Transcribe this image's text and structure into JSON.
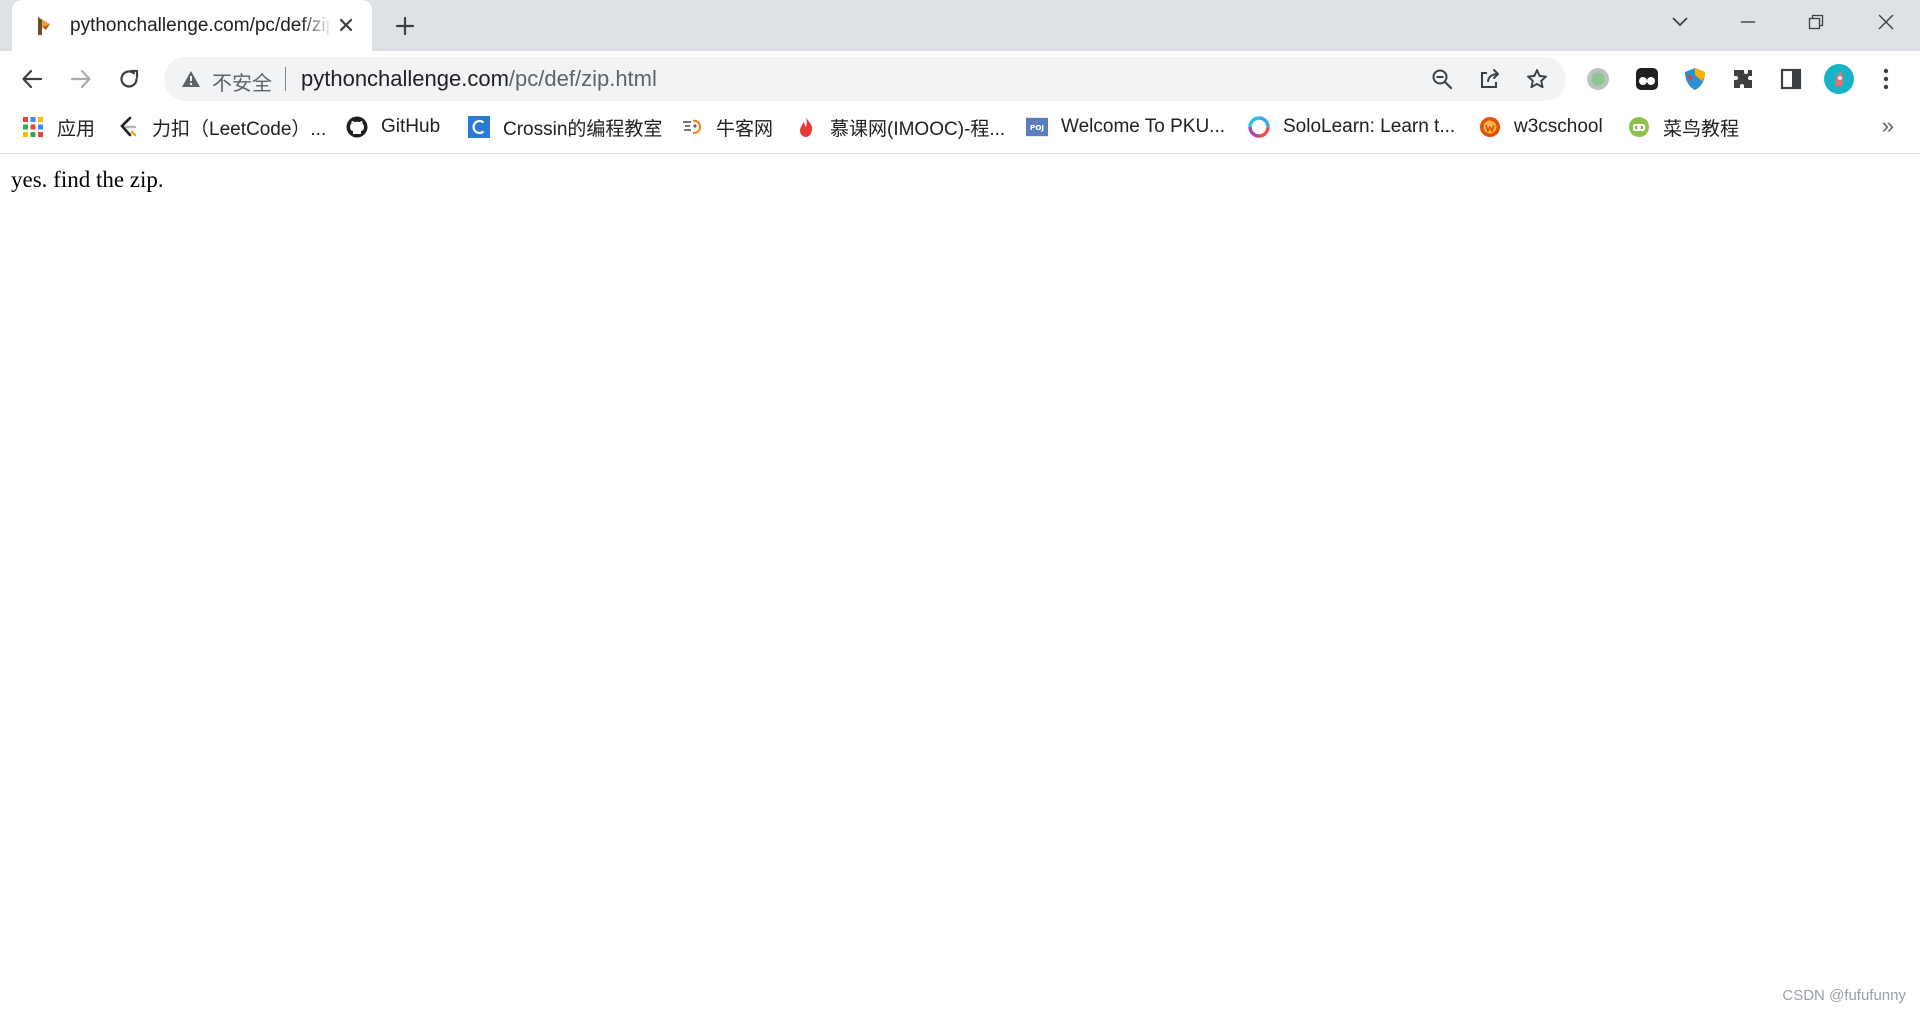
{
  "browser": {
    "tab": {
      "title": "pythonchallenge.com/pc/def/zip.html",
      "favicon": "python-challenge-favicon"
    },
    "new_tab_label": "+",
    "address_bar": {
      "security_label": "不安全",
      "url_host": "pythonchallenge.com",
      "url_path": "/pc/def/zip.html"
    },
    "bookmarks": [
      {
        "label": "应用",
        "icon": "apps-grid-icon"
      },
      {
        "label": "力扣（LeetCode）...",
        "icon": "leetcode-icon"
      },
      {
        "label": "GitHub",
        "icon": "github-icon"
      },
      {
        "label": "Crossin的编程教室",
        "icon": "crossin-icon"
      },
      {
        "label": "牛客网",
        "icon": "nowcoder-icon"
      },
      {
        "label": "慕课网(IMOOC)-程...",
        "icon": "imooc-icon"
      },
      {
        "label": "Welcome To PKU...",
        "icon": "poj-icon"
      },
      {
        "label": "SoloLearn: Learn t...",
        "icon": "sololearn-icon"
      },
      {
        "label": "w3cschool",
        "icon": "w3cschool-icon"
      },
      {
        "label": "菜鸟教程",
        "icon": "runoob-icon"
      }
    ],
    "bookmarks_more": "»",
    "colors": {
      "tabstrip": "#dee1e6",
      "omnibox": "#f1f3f4",
      "accent": "#1a73e8"
    }
  },
  "page": {
    "text": "yes. find the zip."
  },
  "watermark": "CSDN @fufufunny"
}
